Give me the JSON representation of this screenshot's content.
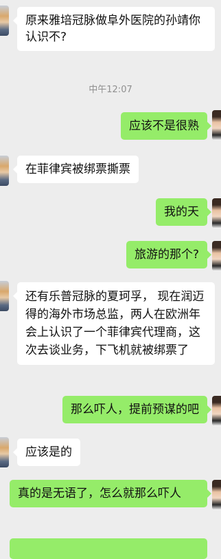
{
  "timestamp": "中午12:07",
  "messages": [
    {
      "side": "in",
      "text": "原来雅培冠脉做阜外医院的孙靖你认识不?"
    },
    {
      "side": "out",
      "text": "应该不是很熟"
    },
    {
      "side": "in",
      "text": "在菲律宾被绑票撕票"
    },
    {
      "side": "out",
      "text": "我的天"
    },
    {
      "side": "out",
      "text": "旅游的那个?"
    },
    {
      "side": "in",
      "text": "还有乐普冠脉的夏珂孚， 现在润迈得的海外市场总监，两人在欧洲年会上认识了一个菲律宾代理商，这次去谈业务，下飞机就被绑票了"
    },
    {
      "side": "out",
      "text": "那么吓人，提前预谋的吧"
    },
    {
      "side": "in",
      "text": "应该是的"
    },
    {
      "side": "out",
      "text": "真的是无语了，怎么就那么吓人"
    }
  ]
}
